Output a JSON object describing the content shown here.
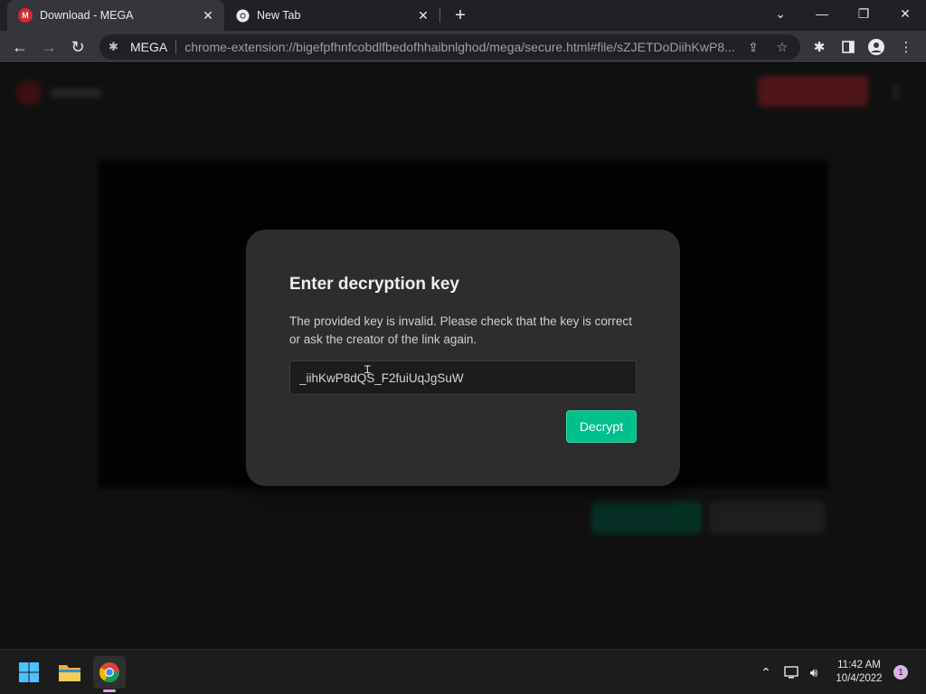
{
  "browser": {
    "tabs": [
      {
        "title": "Download - MEGA",
        "active": true,
        "favicon": "mega-icon"
      },
      {
        "title": "New Tab",
        "active": false,
        "favicon": "chrome-icon"
      }
    ],
    "address": {
      "site_label": "MEGA",
      "url": "chrome-extension://bigefpfhnfcobdlfbedofhhaibnlghod/mega/secure.html#file/sZJETDoDiihKwP8..."
    }
  },
  "dialog": {
    "title": "Enter decryption key",
    "message": "The provided key is invalid. Please check that the key is correct or ask the creator of the link again.",
    "key_value": "_iihKwP8dQS_F2fuiUqJgSuW",
    "button_label": "Decrypt"
  },
  "taskbar": {
    "time": "11:42 AM",
    "date": "10/4/2022",
    "notification_count": "1"
  },
  "colors": {
    "accent_green": "#00c08b",
    "mega_red": "#d9272e",
    "dialog_bg": "#2d2d2d"
  }
}
